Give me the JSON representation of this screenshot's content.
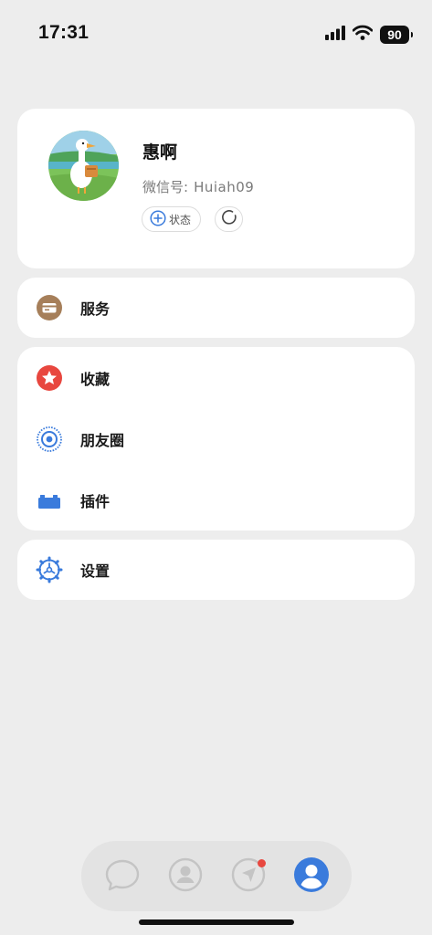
{
  "status_bar": {
    "time": "17:31",
    "battery": "90"
  },
  "profile": {
    "name": "惠啊",
    "wechat_id_label": "微信号:",
    "wechat_id": "Huiah09",
    "status_label": "状态"
  },
  "menu": {
    "services": {
      "label": "服务",
      "icon": "wallet-card-icon"
    },
    "favorites": {
      "label": "收藏",
      "icon": "star-icon"
    },
    "moments": {
      "label": "朋友圈",
      "icon": "moments-lens-icon"
    },
    "plugins": {
      "label": "插件",
      "icon": "brick-icon"
    },
    "settings": {
      "label": "设置",
      "icon": "gear-icon"
    }
  },
  "tab_bar": {
    "tabs": [
      {
        "icon": "chat-bubble-icon",
        "active": false
      },
      {
        "icon": "contacts-icon",
        "active": false
      },
      {
        "icon": "discover-compass-icon",
        "active": false,
        "badge_dot": true
      },
      {
        "icon": "me-icon",
        "active": true
      }
    ]
  },
  "colors": {
    "background": "#ededed",
    "card": "#ffffff",
    "accent_blue": "#3a7bdc",
    "favorites_red": "#e8473f",
    "services_brown": "#a67f5a",
    "badge_red": "#e8473f",
    "inactive_icon": "#c4c4c4"
  }
}
